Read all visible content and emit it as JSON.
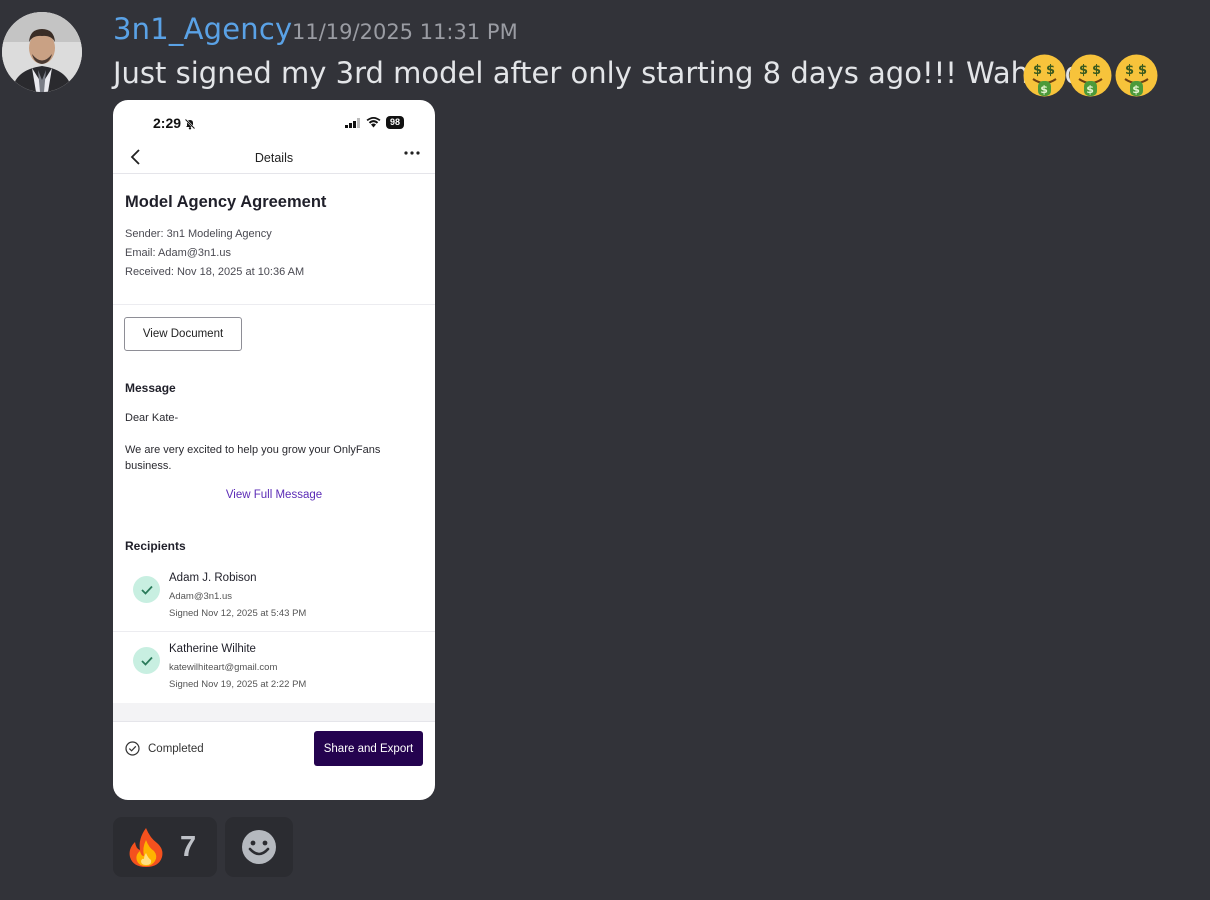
{
  "message": {
    "author": "3n1_Agency",
    "timestamp": "11/19/2025 11:31 PM",
    "text": "Just signed my 3rd model after only starting 8 days ago!!! Wahooo!!",
    "emojis": [
      "money-mouth-face",
      "money-mouth-face",
      "money-mouth-face"
    ]
  },
  "phone": {
    "status_time": "2:29",
    "battery": "98",
    "nav_title": "Details",
    "doc_title": "Model Agency Agreement",
    "sender": "Sender: 3n1 Modeling Agency",
    "email": "Email: Adam@3n1.us",
    "received": "Received: Nov 18, 2025 at 10:36 AM",
    "view_document": "View Document",
    "message_heading": "Message",
    "greeting": "Dear Kate-",
    "body": "We are very excited to help you grow your OnlyFans business.",
    "view_full_message": "View Full Message",
    "recipients_heading": "Recipients",
    "recipients": [
      {
        "name": "Adam J. Robison",
        "email": "Adam@3n1.us",
        "signed": "Signed Nov 12, 2025 at 5:43 PM"
      },
      {
        "name": "Katherine Wilhite",
        "email": "katewilhiteart@gmail.com",
        "signed": "Signed Nov 19, 2025 at 2:22 PM"
      }
    ],
    "status_label": "Completed",
    "share_button": "Share and Export"
  },
  "reactions": [
    {
      "emoji": "fire",
      "count": "7"
    }
  ],
  "colors": {
    "background": "#323339",
    "author": "#5aa2e6",
    "share_button": "#24034f",
    "link": "#5b2bb6",
    "check_bg": "#c8efe1"
  }
}
